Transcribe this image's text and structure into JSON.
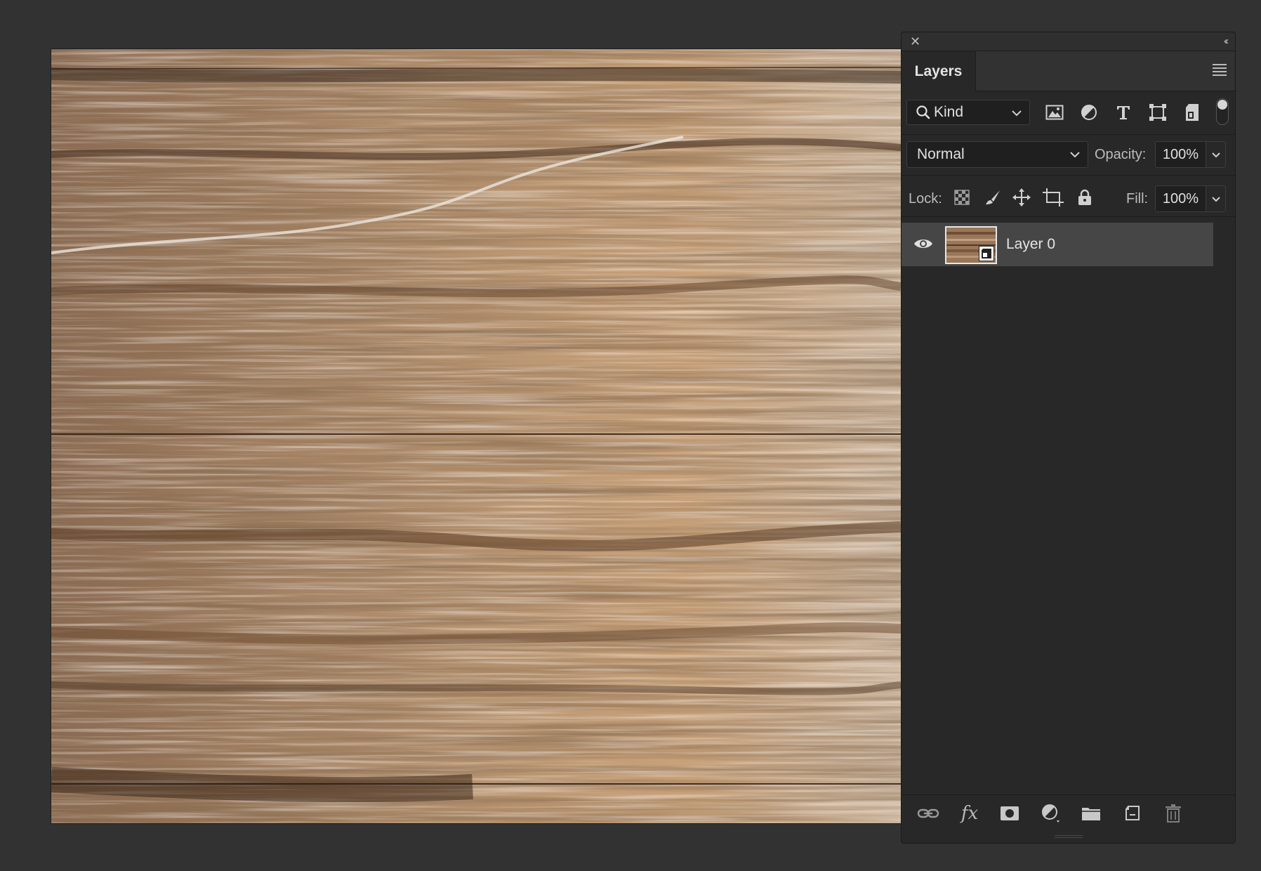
{
  "panel": {
    "close_glyph": "✕",
    "collapse_glyph": "‹‹",
    "tab_label": "Layers",
    "menu_icon": "hamburger-icon"
  },
  "filter": {
    "kind_label": "Kind",
    "icons": [
      "pixel-filter-icon",
      "adjustment-filter-icon",
      "type-filter-icon",
      "shape-filter-icon",
      "smart-object-filter-icon"
    ]
  },
  "blend": {
    "mode": "Normal",
    "opacity_label": "Opacity:",
    "opacity_value": "100%"
  },
  "lock": {
    "label": "Lock:",
    "fill_label": "Fill:",
    "fill_value": "100%"
  },
  "layers": [
    {
      "name": "Layer 0",
      "visible": true,
      "type": "smart-object"
    }
  ],
  "bottom_icons": [
    "link-layers-icon",
    "fx-icon",
    "layer-mask-icon",
    "adjustment-layer-icon",
    "new-group-icon",
    "new-layer-icon",
    "trash-icon"
  ],
  "fx_label": "fx",
  "colors": {
    "app_bg": "#323232",
    "panel_bg": "#282828",
    "selected_layer": "#464646"
  }
}
